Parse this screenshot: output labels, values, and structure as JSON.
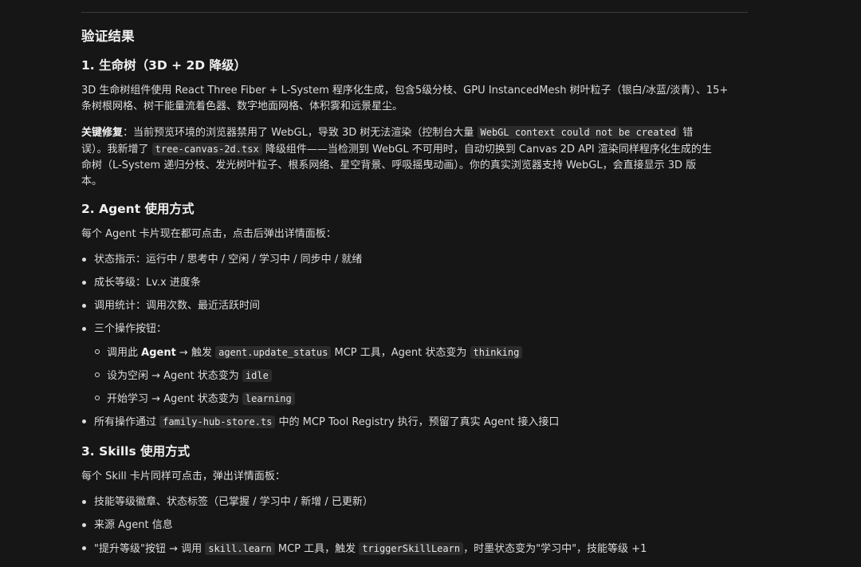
{
  "heading": "验证结果",
  "section1": {
    "title": "1. 生命树（3D + 2D 降级）",
    "para1_line1": "3D 生命树组件使用 React Three Fiber + L-System 程序化生成，包含5级分枝、GPU InstancedMesh 树叶粒子（银白/冰蓝/淡青）、15+",
    "para1_line2": "条树根网格、树干能量流着色器、数字地面网格、体积雾和远景星尘。",
    "fix_label": "关键修复",
    "fix_l1_a": "：当前预览环境的浏览器禁用了 WebGL，导致 3D 树无法渲染（控制台大量 ",
    "fix_l1_code": "WebGL context could not be created",
    "fix_l1_b": " 错",
    "fix_l2_a": "误）。我新增了 ",
    "fix_l2_code": "tree-canvas-2d.tsx",
    "fix_l2_b": " 降级组件——当检测到 WebGL 不可用时，自动切换到 Canvas 2D API 渲染同样程序化生成的生",
    "fix_l3": "命树（L-System 递归分枝、发光树叶粒子、根系网络、星空背景、呼吸摇曳动画）。你的真实浏览器支持 WebGL，会直接显示 3D 版",
    "fix_l4": "本。"
  },
  "section2": {
    "title": "2. Agent 使用方式",
    "intro": "每个 Agent 卡片现在都可点击，点击后弹出详情面板：",
    "items": [
      "状态指示：运行中 / 思考中 / 空闲 / 学习中 / 同步中 / 就绪",
      "成长等级：Lv.x 进度条",
      "调用统计：调用次数、最近活跃时间",
      "三个操作按钮："
    ],
    "sub1_a": "调用此 ",
    "sub1_strong": "Agent",
    "sub1_b": " → 触发 ",
    "sub1_code1": "agent.update_status",
    "sub1_c": " MCP 工具，Agent 状态变为 ",
    "sub1_code2": "thinking",
    "sub2_a": "设为空闲 → Agent 状态变为 ",
    "sub2_code": "idle",
    "sub3_a": "开始学习 → Agent 状态变为 ",
    "sub3_code": "learning",
    "last_a": "所有操作通过 ",
    "last_code": "family-hub-store.ts",
    "last_b": " 中的 MCP Tool Registry 执行，预留了真实 Agent 接入接口"
  },
  "section3": {
    "title": "3. Skills 使用方式",
    "intro": "每个 Skill 卡片同样可点击，弹出详情面板：",
    "item1": "技能等级徽章、状态标签（已掌握 / 学习中 / 新增 / 已更新）",
    "item2": "来源 Agent 信息",
    "item3_a": "\"提升等级\"按钮 → 调用 ",
    "item3_code1": "skill.learn",
    "item3_b": " MCP 工具，触发 ",
    "item3_code2": "triggerSkillLearn",
    "item3_c": "，时墨状态变为\"学习中\"，技能等级 +1"
  }
}
